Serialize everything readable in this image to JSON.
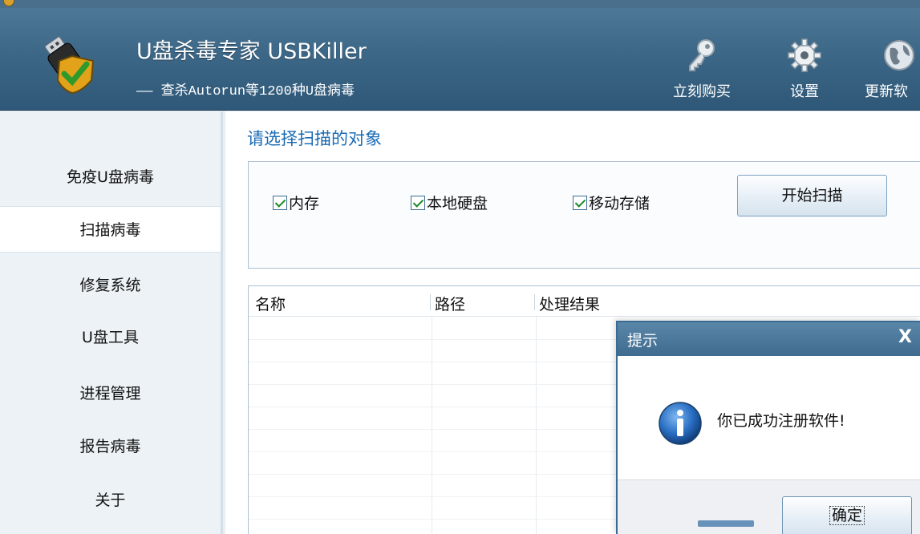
{
  "window": {
    "title": "U盘杀毒"
  },
  "header": {
    "app_title": "U盘杀毒专家   USBKiller",
    "app_subtitle": "—— 查杀Autorun等1200种U盘病毒",
    "buttons": [
      {
        "label": "立刻购买",
        "icon": "key-icon"
      },
      {
        "label": "设置",
        "icon": "gear-icon"
      },
      {
        "label": "更新软",
        "icon": "globe-icon"
      }
    ]
  },
  "sidebar": {
    "items": [
      {
        "label": "免疫U盘病毒",
        "active": false
      },
      {
        "label": "扫描病毒",
        "active": true
      },
      {
        "label": "修复系统",
        "active": false
      },
      {
        "label": "U盘工具",
        "active": false
      },
      {
        "label": "进程管理",
        "active": false
      },
      {
        "label": "报告病毒",
        "active": false
      },
      {
        "label": "关于",
        "active": false
      }
    ]
  },
  "main": {
    "section_title": "请选择扫描的对象",
    "checkboxes": [
      {
        "label": "内存",
        "checked": true
      },
      {
        "label": "本地硬盘",
        "checked": true
      },
      {
        "label": "移动存储",
        "checked": true
      }
    ],
    "scan_button": "开始扫描",
    "table": {
      "columns": [
        "名称",
        "路径",
        "处理结果"
      ],
      "rows": []
    }
  },
  "dialog": {
    "title": "提示",
    "close": "X",
    "message": "你已成功注册软件!",
    "ok_button": "确定",
    "icon": "info-icon"
  },
  "colors": {
    "header_bg": "#3d6787",
    "accent_blue": "#1b6bb5",
    "check_green": "#1a8a25"
  }
}
